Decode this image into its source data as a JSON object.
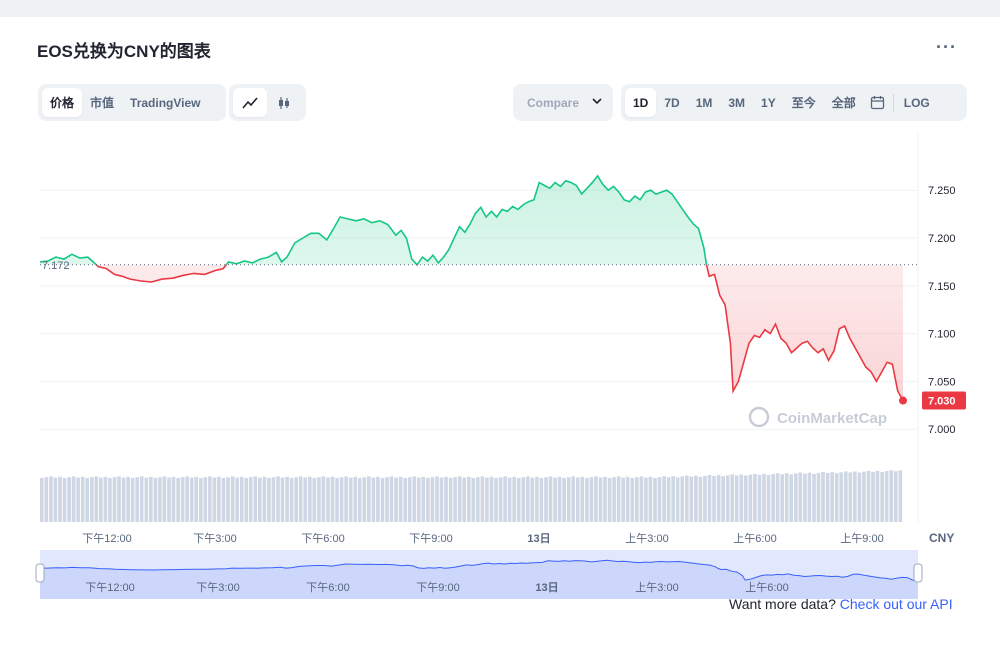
{
  "title": "EOS兑换为CNY的图表",
  "toolbar": {
    "price_tabs": [
      "价格",
      "市值",
      "TradingView"
    ],
    "active_price_tab": "价格",
    "compare_label": "Compare",
    "range_tabs": [
      "1D",
      "7D",
      "1M",
      "3M",
      "1Y",
      "至今",
      "全部"
    ],
    "active_range_tab": "1D",
    "log_label": "LOG"
  },
  "footer": {
    "prefix": "Want more data?",
    "link": "Check out our API"
  },
  "watermark": "CoinMarketCap",
  "colors": {
    "up": "#16c784",
    "down": "#ea3943",
    "navigator_line": "#3861fb",
    "navigator_fill": "#e1e7fd",
    "volume": "#cfd6e4",
    "grid": "#eff2f5"
  },
  "chart_data": {
    "type": "line",
    "currency": "CNY",
    "reference_price": 7.172,
    "reference_label": "7.172",
    "current_price": 7.03,
    "current_label": "7.030",
    "ylim": [
      6.95,
      7.29
    ],
    "yticks": [
      7.0,
      7.05,
      7.1,
      7.15,
      7.2,
      7.25
    ],
    "ytick_labels": [
      "7.000",
      "7.050",
      "7.100",
      "7.150",
      "7.200",
      "7.250"
    ],
    "x_range_hours": [
      0,
      24
    ],
    "xticks_hours": [
      3,
      6,
      9,
      12,
      15,
      18,
      21
    ],
    "xtick_labels": [
      "下午12:00",
      "下午3:00",
      "下午6:00",
      "下午9:00",
      "13日",
      "上午3:00",
      "上午6:00",
      "上午9:00"
    ],
    "xtick_label_hours": [
      1.5,
      4.5,
      7.5,
      10.5,
      13.5,
      16.5,
      19.5,
      22.5
    ],
    "series": [
      {
        "points": [
          [
            0.0,
            7.175
          ],
          [
            0.3,
            7.176
          ],
          [
            0.6,
            7.18
          ],
          [
            0.9,
            7.178
          ],
          [
            1.2,
            7.183
          ],
          [
            1.5,
            7.179
          ],
          [
            1.8,
            7.18
          ],
          [
            2.0,
            7.175
          ],
          [
            2.2,
            7.17
          ],
          [
            2.5,
            7.168
          ],
          [
            2.8,
            7.162
          ],
          [
            3.1,
            7.16
          ],
          [
            3.4,
            7.157
          ],
          [
            3.8,
            7.155
          ],
          [
            4.2,
            7.154
          ],
          [
            4.6,
            7.157
          ],
          [
            5.0,
            7.158
          ],
          [
            5.4,
            7.161
          ],
          [
            5.8,
            7.163
          ],
          [
            6.2,
            7.162
          ],
          [
            6.6,
            7.166
          ],
          [
            6.9,
            7.168
          ],
          [
            7.1,
            7.175
          ],
          [
            7.4,
            7.173
          ],
          [
            7.7,
            7.176
          ],
          [
            8.0,
            7.174
          ],
          [
            8.3,
            7.178
          ],
          [
            8.6,
            7.18
          ],
          [
            8.9,
            7.185
          ],
          [
            9.1,
            7.175
          ],
          [
            9.3,
            7.18
          ],
          [
            9.6,
            7.195
          ],
          [
            9.9,
            7.2
          ],
          [
            10.2,
            7.205
          ],
          [
            10.5,
            7.205
          ],
          [
            10.8,
            7.198
          ],
          [
            11.1,
            7.212
          ],
          [
            11.3,
            7.222
          ],
          [
            11.6,
            7.22
          ],
          [
            11.9,
            7.218
          ],
          [
            12.2,
            7.22
          ],
          [
            12.5,
            7.216
          ],
          [
            12.8,
            7.218
          ],
          [
            13.1,
            7.214
          ],
          [
            13.4,
            7.203
          ],
          [
            13.6,
            7.208
          ],
          [
            13.8,
            7.2
          ],
          [
            14.0,
            7.178
          ],
          [
            14.2,
            7.172
          ],
          [
            14.4,
            7.18
          ],
          [
            14.6,
            7.176
          ],
          [
            14.8,
            7.182
          ],
          [
            15.0,
            7.174
          ],
          [
            15.2,
            7.18
          ],
          [
            15.4,
            7.188
          ],
          [
            15.6,
            7.2
          ],
          [
            15.8,
            7.212
          ],
          [
            16.0,
            7.206
          ],
          [
            16.2,
            7.215
          ],
          [
            16.4,
            7.226
          ],
          [
            16.6,
            7.232
          ],
          [
            16.8,
            7.222
          ],
          [
            17.0,
            7.228
          ],
          [
            17.2,
            7.222
          ],
          [
            17.4,
            7.23
          ],
          [
            17.6,
            7.228
          ],
          [
            17.8,
            7.233
          ],
          [
            18.0,
            7.23
          ],
          [
            18.2,
            7.235
          ],
          [
            18.4,
            7.238
          ],
          [
            18.6,
            7.24
          ],
          [
            18.8,
            7.258
          ],
          [
            19.0,
            7.255
          ],
          [
            19.2,
            7.252
          ],
          [
            19.4,
            7.258
          ],
          [
            19.6,
            7.254
          ],
          [
            19.8,
            7.26
          ],
          [
            20.0,
            7.258
          ],
          [
            20.2,
            7.255
          ],
          [
            20.4,
            7.246
          ],
          [
            20.6,
            7.252
          ],
          [
            20.8,
            7.258
          ],
          [
            21.0,
            7.265
          ],
          [
            21.2,
            7.256
          ],
          [
            21.4,
            7.25
          ],
          [
            21.6,
            7.254
          ],
          [
            21.8,
            7.248
          ],
          [
            22.0,
            7.24
          ],
          [
            22.2,
            7.238
          ],
          [
            22.4,
            7.244
          ],
          [
            22.6,
            7.24
          ],
          [
            22.8,
            7.248
          ],
          [
            23.0,
            7.25
          ],
          [
            23.2,
            7.246
          ],
          [
            23.4,
            7.248
          ],
          [
            23.6,
            7.25
          ],
          [
            23.8,
            7.246
          ],
          [
            24.0,
            7.238
          ],
          [
            24.2,
            7.23
          ],
          [
            24.4,
            7.222
          ],
          [
            24.6,
            7.215
          ],
          [
            24.8,
            7.21
          ],
          [
            25.0,
            7.19
          ],
          [
            25.1,
            7.172
          ],
          [
            25.2,
            7.16
          ],
          [
            25.4,
            7.162
          ],
          [
            25.6,
            7.14
          ],
          [
            25.8,
            7.13
          ],
          [
            26.0,
            7.09
          ],
          [
            26.1,
            7.04
          ],
          [
            26.3,
            7.05
          ],
          [
            26.5,
            7.07
          ],
          [
            26.7,
            7.09
          ],
          [
            26.9,
            7.098
          ],
          [
            27.1,
            7.096
          ],
          [
            27.3,
            7.104
          ],
          [
            27.5,
            7.1
          ],
          [
            27.7,
            7.11
          ],
          [
            27.9,
            7.095
          ],
          [
            28.1,
            7.09
          ],
          [
            28.3,
            7.08
          ],
          [
            28.5,
            7.085
          ],
          [
            28.7,
            7.09
          ],
          [
            28.9,
            7.092
          ],
          [
            29.1,
            7.085
          ],
          [
            29.3,
            7.08
          ],
          [
            29.5,
            7.084
          ],
          [
            29.7,
            7.072
          ],
          [
            29.9,
            7.082
          ],
          [
            30.1,
            7.105
          ],
          [
            30.3,
            7.108
          ],
          [
            30.5,
            7.095
          ],
          [
            30.7,
            7.085
          ],
          [
            30.9,
            7.075
          ],
          [
            31.1,
            7.065
          ],
          [
            31.3,
            7.06
          ],
          [
            31.5,
            7.05
          ],
          [
            31.7,
            7.06
          ],
          [
            31.9,
            7.07
          ],
          [
            32.1,
            7.068
          ],
          [
            32.3,
            7.04
          ],
          [
            32.5,
            7.03
          ]
        ]
      }
    ],
    "x_range": [
      0,
      32.5
    ]
  }
}
